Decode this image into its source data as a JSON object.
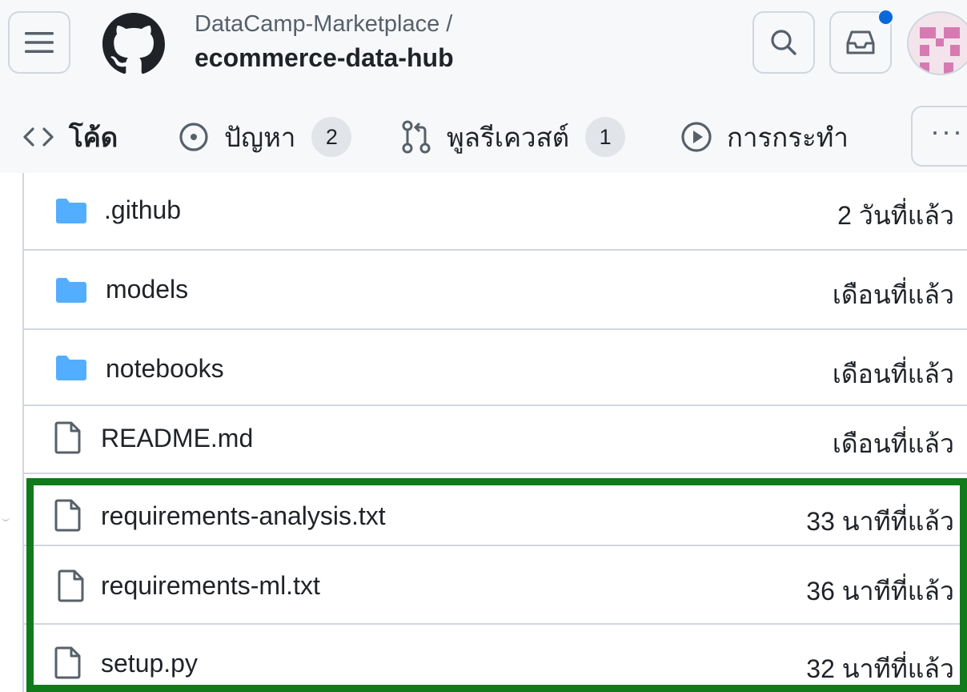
{
  "header": {
    "owner": "DataCamp-Marketplace /",
    "repo": "ecommerce-data-hub",
    "icons": {
      "menu": "hamburger-menu-icon",
      "logo": "github-logo",
      "search": "search-icon",
      "inbox": "inbox-icon",
      "notification_color": "#0969da"
    }
  },
  "tabs": [
    {
      "label": "โค้ด",
      "icon": "code-icon",
      "active": true
    },
    {
      "label": "ปัญหา",
      "icon": "issue-icon",
      "count": "2"
    },
    {
      "label": "พูลรีเควสต์",
      "icon": "pull-request-icon",
      "count": "1"
    },
    {
      "label": "การกระทำ",
      "icon": "play-icon"
    }
  ],
  "more_label": "···",
  "files": [
    {
      "name": ".github",
      "type": "folder",
      "date": "2 วันที่แล้ว"
    },
    {
      "name": "models",
      "type": "folder",
      "date": "เดือนที่แล้ว"
    },
    {
      "name": "notebooks",
      "type": "folder",
      "date": "เดือนที่แล้ว"
    },
    {
      "name": "README.md",
      "type": "file",
      "date": "เดือนที่แล้ว"
    },
    {
      "name": "requirements-analysis.txt",
      "type": "file",
      "date": "33 นาทีที่แล้ว"
    },
    {
      "name": "requirements-ml.txt",
      "type": "file",
      "date": "36 นาทีที่แล้ว"
    },
    {
      "name": "setup.py",
      "type": "file",
      "date": "32 นาทีที่แล้ว"
    }
  ],
  "colors": {
    "folder": "#54aeff",
    "highlight": "#117a1b",
    "header_bg": "#f6f8fa"
  }
}
